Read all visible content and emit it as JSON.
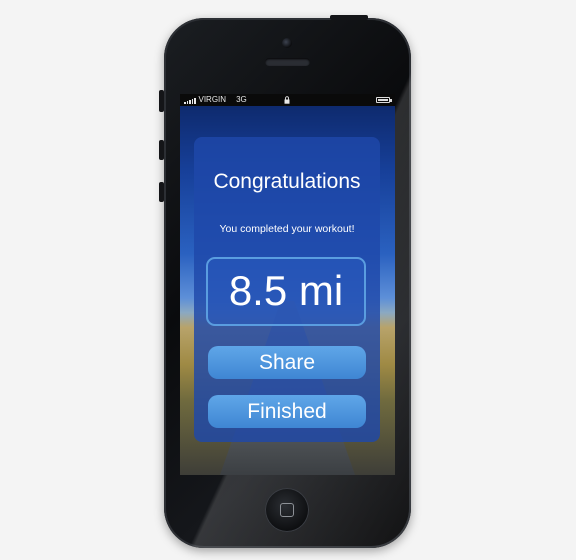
{
  "status_bar": {
    "carrier": "VIRGIN",
    "network": "3G"
  },
  "dialog": {
    "title": "Congratulations",
    "message": "You completed your workout!",
    "distance": "8.5 mi",
    "share_label": "Share",
    "finished_label": "Finished"
  },
  "colors": {
    "card": "#1e48aa",
    "button": "#4a92dc",
    "distance_border": "#5a9de0",
    "text": "#ffffff"
  },
  "icons": [
    "signal-bars-icon",
    "lock-icon",
    "battery-icon",
    "home-button-icon"
  ]
}
